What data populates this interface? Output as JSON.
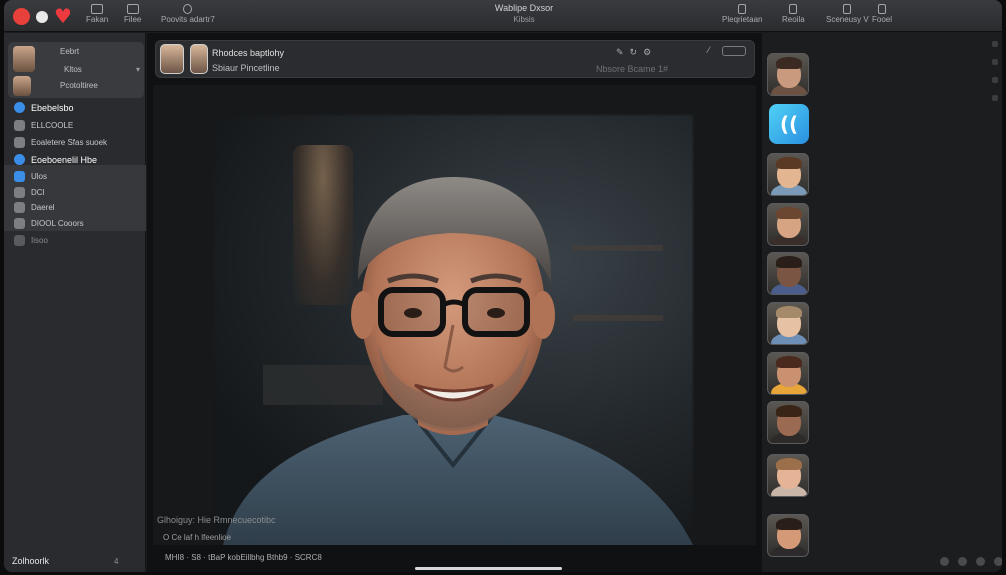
{
  "window": {
    "title": "Wablipe Dxsor",
    "subtitle": "Kibsis"
  },
  "toolbar": {
    "items_left": [
      {
        "label": "Fakan"
      },
      {
        "label": "Filee"
      },
      {
        "label": "Poovits adartr7"
      }
    ],
    "items_right": [
      {
        "label": "Pleqrietaan"
      },
      {
        "label": "Reoila"
      },
      {
        "label": "Sceneusy V"
      },
      {
        "label": "Fooel"
      }
    ]
  },
  "sidebar": {
    "card": {
      "title": "Eebrt",
      "line1": "Kltos",
      "line2": "Pcotoltiree"
    },
    "items": [
      {
        "label": "Ebebelsbo"
      },
      {
        "label": "ELLCOOLE"
      },
      {
        "label": "Eoaletere Sfas suoek"
      },
      {
        "label": "Eoeboenelil Hbe"
      },
      {
        "label": "Ulos"
      },
      {
        "label": "DCI"
      },
      {
        "label": "Daerel"
      },
      {
        "label": "DIOOL Cooors"
      },
      {
        "label": "Iisoo"
      }
    ],
    "footer": "Zolhoorlk",
    "footer_x": "4"
  },
  "call": {
    "name": "Rhodces baptlohy",
    "subtitle": "Sbiaur Pincetline",
    "right_text": "Nbsore Bcame 1#",
    "icons": [
      "chat-icon",
      "refresh-icon",
      "settings-icon"
    ],
    "captions": [
      "Glhoiguy: Hie Rmnecuecotibc",
      "O Ce laf h lfeenlioe",
      "MHI8 · S8 · tBaP  kobEillbhg Bthb9 · SCRC8"
    ]
  },
  "participants": [
    {
      "name": "participant-1",
      "skin": "#c99a7d",
      "shirt": "#6b5242",
      "hair": "#3a2a22"
    },
    {
      "name": "app-tile",
      "glyph": "(("
    },
    {
      "name": "participant-2",
      "skin": "#e3b590",
      "shirt": "#7a9ab8",
      "hair": "#5a3a24"
    },
    {
      "name": "participant-3",
      "skin": "#d7a483",
      "shirt": "#3a2e2a",
      "hair": "#6b4630"
    },
    {
      "name": "participant-4",
      "skin": "#7b5544",
      "shirt": "#4b5d8a",
      "hair": "#2a1e18"
    },
    {
      "name": "participant-5",
      "skin": "#e6c1a3",
      "shirt": "#6d8fb6",
      "hair": "#a58a6a"
    },
    {
      "name": "participant-6",
      "skin": "#c99170",
      "shirt": "#e8a53a",
      "hair": "#4a2a1c"
    },
    {
      "name": "participant-7",
      "skin": "#9a6a52",
      "shirt": "#2e2a29",
      "hair": "#3a2418"
    },
    {
      "name": "participant-8",
      "skin": "#e5b497",
      "shirt": "#c9b6a8",
      "hair": "#9a6f4a"
    },
    {
      "name": "participant-9",
      "skin": "#d49a78",
      "shirt": "#2c2a2a",
      "hair": "#2a1e18"
    }
  ],
  "colors": {
    "accent_red": "#e8403a",
    "sidebar_bg": "#2a2b2e",
    "link_blue": "#3b8ee8"
  }
}
